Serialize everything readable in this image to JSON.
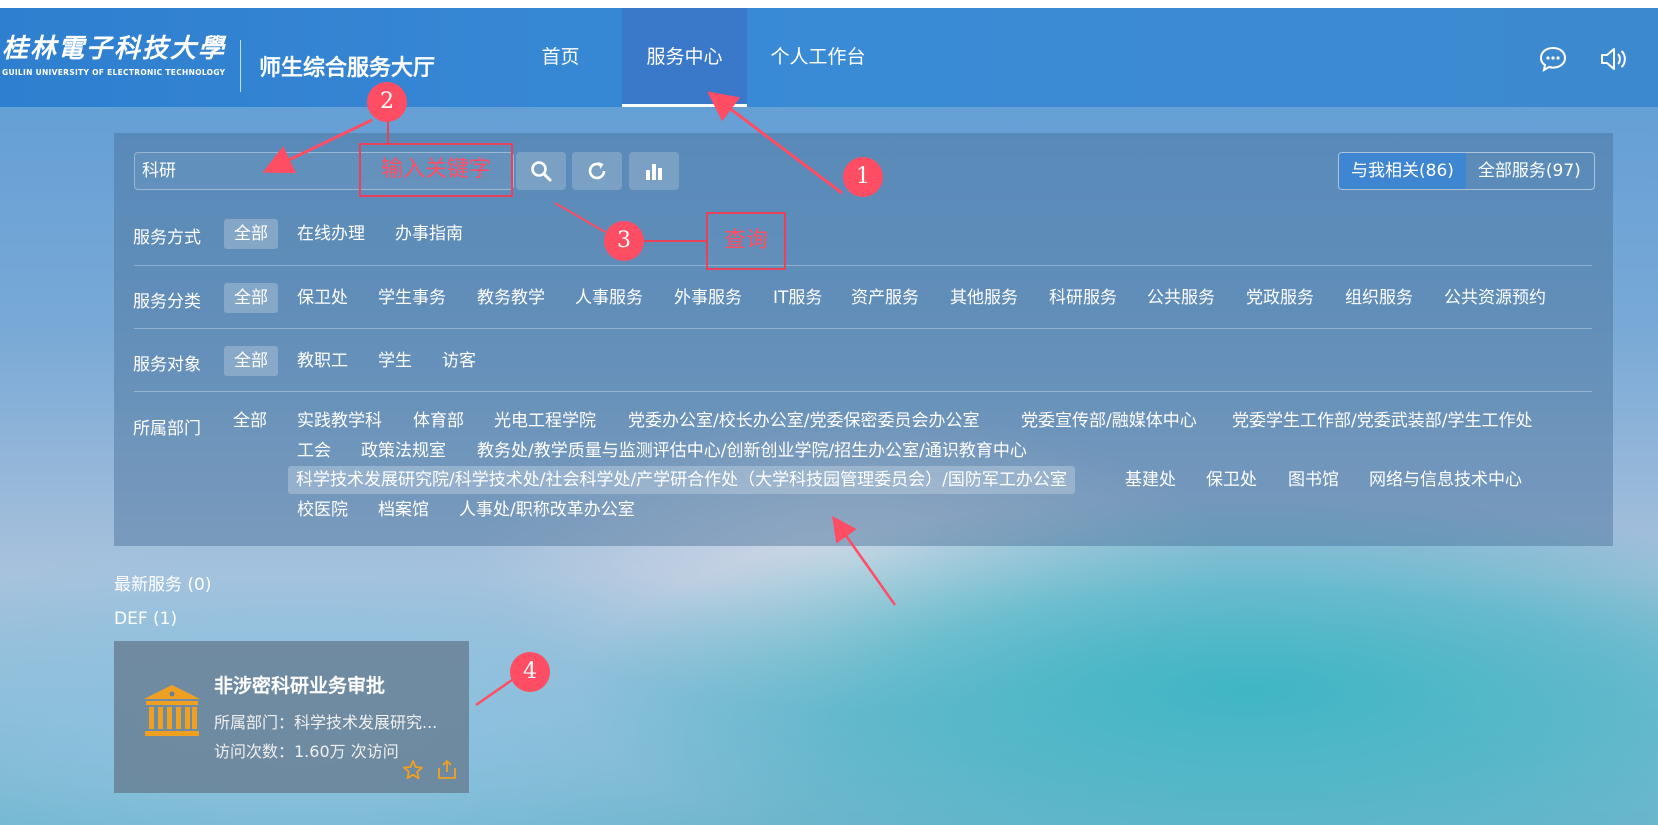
{
  "header": {
    "logo_cn": "桂林電子科技大學",
    "logo_en": "GUILIN UNIVERSITY OF ELECTRONIC TECHNOLOGY",
    "site_title": "师生综合服务大厅",
    "nav": [
      {
        "label": "首页"
      },
      {
        "label": "服务中心"
      },
      {
        "label": "个人工作台"
      }
    ]
  },
  "search": {
    "value": "科研",
    "scope_related": "与我相关(86)",
    "scope_all": "全部服务(97)"
  },
  "filters": {
    "method": {
      "label": "服务方式",
      "options": [
        "全部",
        "在线办理",
        "办事指南"
      ]
    },
    "category": {
      "label": "服务分类",
      "options": [
        "全部",
        "保卫处",
        "学生事务",
        "教务教学",
        "人事服务",
        "外事服务",
        "IT服务",
        "资产服务",
        "其他服务",
        "科研服务",
        "公共服务",
        "党政服务",
        "组织服务",
        "公共资源预约"
      ]
    },
    "audience": {
      "label": "服务对象",
      "options": [
        "全部",
        "教职工",
        "学生",
        "访客"
      ]
    },
    "department": {
      "label": "所属部门",
      "options": [
        "全部",
        "实践教学科",
        "体育部",
        "光电工程学院",
        "党委办公室/校长办公室/党委保密委员会办公室",
        "党委宣传部/融媒体中心",
        "党委学生工作部/党委武装部/学生工作处",
        "工会",
        "政策法规室",
        "教务处/教学质量与监测评估中心/创新创业学院/招生办公室/通识教育中心",
        "科学技术发展研究院/科学技术处/社会科学处/产学研合作处（大学科技园管理委员会）/国防军工办公室",
        "基建处",
        "保卫处",
        "图书馆",
        "网络与信息技术中心",
        "校医院",
        "档案馆",
        "人事处/职称改革办公室"
      ]
    }
  },
  "sections": {
    "latest": "最新服务 (0)",
    "def": "DEF (1)"
  },
  "card": {
    "title": "非涉密科研业务审批",
    "dept": "所属部门：科学技术发展研究...",
    "visits": "访问次数：1.60万 次访问"
  },
  "annotations": {
    "n1": "1",
    "n2": "2",
    "n3": "3",
    "n4": "4",
    "box_keyword": "输入关键字",
    "box_query": "查询"
  },
  "colors": {
    "header": "#3a8bd6",
    "annotation": "#ff4d63",
    "card_icon": "#f0a020"
  }
}
